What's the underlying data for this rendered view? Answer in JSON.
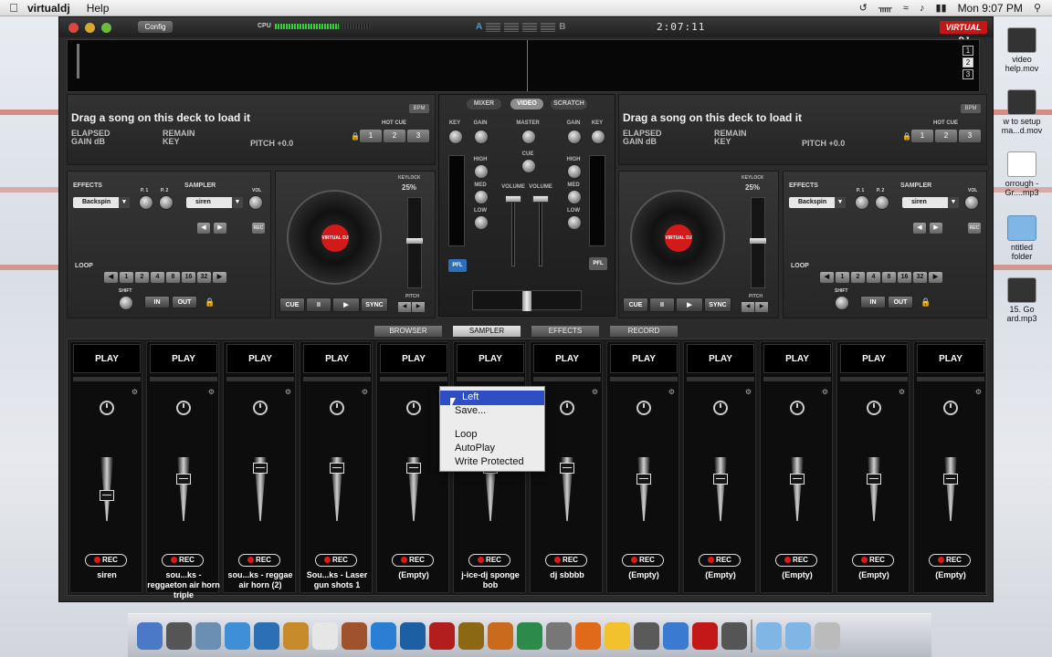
{
  "menubar": {
    "apple": "",
    "app_name": "virtualdj",
    "help": "Help",
    "clock": "Mon 9:07 PM"
  },
  "desktop": {
    "icons": [
      {
        "label": "video\nhelp.mov",
        "icon": "movie-icon"
      },
      {
        "label": "w to setup\nma...d.mov",
        "icon": "movie-icon"
      },
      {
        "label": "orrough -\nGr....mp3",
        "icon": "audio-file-icon"
      },
      {
        "label": "ntitled\nfolder",
        "icon": "folder-icon"
      },
      {
        "label": "15. Go\nard.mp3",
        "icon": "music-icon"
      }
    ]
  },
  "window": {
    "config_label": "Config",
    "cpu_label": "CPU",
    "clock": "2:07:11",
    "logo": "VIRTUAL DJ",
    "deck_numbers": [
      "1",
      "2",
      "3"
    ],
    "active_deck": "2"
  },
  "deck_left": {
    "title": "Drag a song on this deck to load it",
    "elapsed": "ELAPSED",
    "gain": "GAIN dB",
    "remain": "REMAIN",
    "key": "KEY",
    "pitch": "PITCH +0.0",
    "bpm_label": "BPM",
    "hotcue_label": "HOT CUE",
    "hotcues": [
      "1",
      "2",
      "3"
    ]
  },
  "deck_right": {
    "title": "Drag a song on this deck to load it",
    "elapsed": "ELAPSED",
    "gain": "GAIN dB",
    "remain": "REMAIN",
    "key": "KEY",
    "pitch": "PITCH +0.0",
    "bpm_label": "BPM",
    "hotcue_label": "HOT CUE",
    "hotcues": [
      "1",
      "2",
      "3"
    ]
  },
  "mixer": {
    "tabs": [
      "MIXER",
      "VIDEO",
      "SCRATCH"
    ],
    "active_tab": "VIDEO",
    "key": "KEY",
    "gain": "GAIN",
    "master": "MASTER",
    "cue": "CUE",
    "high": "HIGH",
    "med": "MED",
    "low": "LOW",
    "volume": "VOLUME",
    "pfl": "PFL"
  },
  "fx_left": {
    "effects_label": "EFFECTS",
    "effect": "Backspin",
    "p1": "P. 1",
    "p2": "P. 2",
    "sampler_label": "SAMPLER",
    "sampler": "siren",
    "vol": "VOL",
    "rec": "REC",
    "loop_label": "LOOP",
    "loops": [
      "1",
      "2",
      "4",
      "8",
      "16",
      "32"
    ],
    "shift": "SHIFT",
    "in": "IN",
    "out": "OUT"
  },
  "fx_right": {
    "effects_label": "EFFECTS",
    "effect": "Backspin",
    "p1": "P. 1",
    "p2": "P. 2",
    "sampler_label": "SAMPLER",
    "sampler": "siren",
    "vol": "VOL",
    "rec": "REC",
    "loop_label": "LOOP",
    "loops": [
      "1",
      "2",
      "4",
      "8",
      "16",
      "32"
    ],
    "shift": "SHIFT",
    "in": "IN",
    "out": "OUT"
  },
  "turntable_left": {
    "keylock": "KEYLOCK",
    "percent": "25%",
    "label": "VIRTUAL DJ",
    "cue": "CUE",
    "pause": "II",
    "play": "▶",
    "sync": "SYNC",
    "pitch": "PITCH"
  },
  "turntable_right": {
    "keylock": "KEYLOCK",
    "percent": "25%",
    "label": "VIRTUAL DJ",
    "cue": "CUE",
    "pause": "II",
    "play": "▶",
    "sync": "SYNC",
    "pitch": "PITCH"
  },
  "tabs": [
    "BROWSER",
    "SAMPLER",
    "EFFECTS",
    "RECORD"
  ],
  "active_tab": "SAMPLER",
  "sampler": {
    "play_label": "PLAY",
    "rec_label": "REC",
    "slots": [
      {
        "name": "siren",
        "volume": 0.4
      },
      {
        "name": "sou...ks - reggaeton air horn triple",
        "volume": 0.7
      },
      {
        "name": "sou...ks - reggae air horn (2)",
        "volume": 0.9
      },
      {
        "name": "Sou...ks - Laser gun shots 1",
        "volume": 0.9
      },
      {
        "name": "(Empty)",
        "volume": 0.9
      },
      {
        "name": "j-ice-dj sponge bob",
        "volume": 0.9
      },
      {
        "name": "dj sbbbb",
        "volume": 0.9
      },
      {
        "name": "(Empty)",
        "volume": 0.7
      },
      {
        "name": "(Empty)",
        "volume": 0.7
      },
      {
        "name": "(Empty)",
        "volume": 0.7
      },
      {
        "name": "(Empty)",
        "volume": 0.7
      },
      {
        "name": "(Empty)",
        "volume": 0.7
      }
    ]
  },
  "context_menu": {
    "items": [
      "Left",
      "Save...",
      "Loop",
      "AutoPlay",
      "Write Protected"
    ],
    "highlighted": "Left"
  },
  "dock": {
    "items": [
      "finder-icon",
      "dashboard-icon",
      "preview-icon",
      "safari-icon",
      "facetime-icon",
      "ibooks-icon",
      "calendar-icon",
      "photobooth-icon",
      "itunes-icon",
      "photoshop-icon",
      "photo-icon",
      "preview2-icon",
      "garageband-icon",
      "timemachine-icon",
      "system-prefs-icon",
      "firefox-icon",
      "notes-icon",
      "pencil-icon",
      "chart-icon",
      "virtualdj-icon",
      "recorder-icon",
      "folder-icon",
      "folder2-icon",
      "trash-icon"
    ]
  }
}
